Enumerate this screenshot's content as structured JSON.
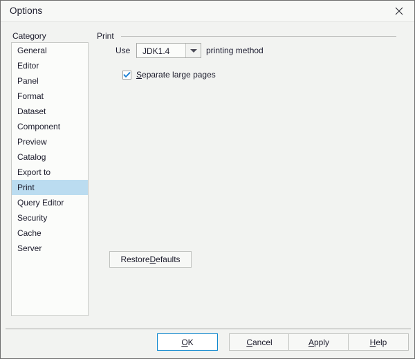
{
  "window": {
    "title": "Options",
    "close_icon": "close-icon"
  },
  "sidebar": {
    "label": "Category",
    "selected": "Print",
    "items": [
      {
        "label": "General"
      },
      {
        "label": "Editor"
      },
      {
        "label": "Panel"
      },
      {
        "label": "Format"
      },
      {
        "label": "Dataset"
      },
      {
        "label": "Component"
      },
      {
        "label": "Preview"
      },
      {
        "label": "Catalog"
      },
      {
        "label": "Export to"
      },
      {
        "label": "Print"
      },
      {
        "label": "Query Editor"
      },
      {
        "label": "Security"
      },
      {
        "label": "Cache"
      },
      {
        "label": "Server"
      }
    ]
  },
  "main": {
    "group_title": "Print",
    "use_label": "Use",
    "method_combo": {
      "value": "JDK1.4",
      "arrow_icon": "chevron-down-icon"
    },
    "method_suffix_pre": "printin",
    "method_suffix_mn": "g",
    "method_suffix_post": " method",
    "separate_pages": {
      "checked": true,
      "mnemonic": "S",
      "label_rest": "eparate large pages",
      "check_icon": "checkmark-icon"
    },
    "restore": {
      "pre": "Restore ",
      "mn": "D",
      "post": "efaults"
    }
  },
  "footer": {
    "buttons": [
      {
        "pre": "",
        "mn": "O",
        "post": "K",
        "default": true
      },
      {
        "pre": "",
        "mn": "C",
        "post": "ancel",
        "default": false
      },
      {
        "pre": "",
        "mn": "A",
        "post": "pply",
        "default": false
      },
      {
        "pre": "",
        "mn": "H",
        "post": "elp",
        "default": false
      }
    ]
  },
  "colors": {
    "selection": "#bbdcf0",
    "accent": "#1088cf",
    "check": "#1a7fd4",
    "window_bg": "#f2f3f1",
    "field_bg": "#fbfcfa"
  }
}
